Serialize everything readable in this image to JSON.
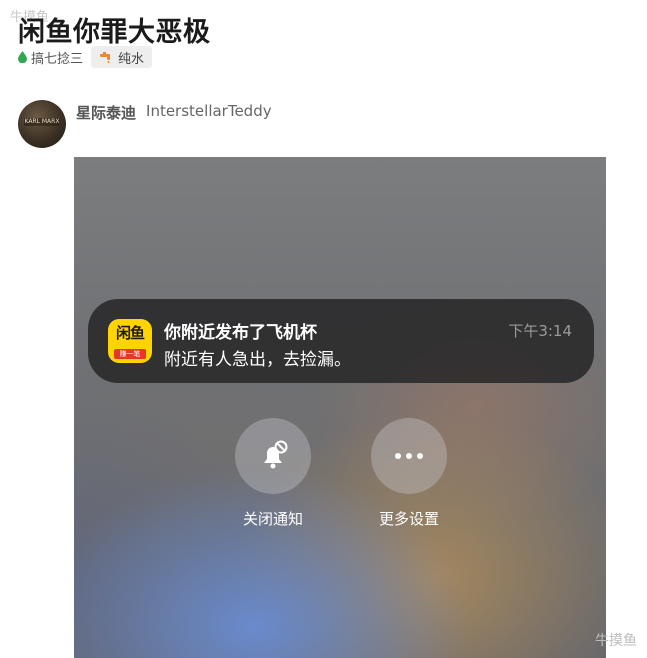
{
  "watermark": "牛摸鱼",
  "post": {
    "title": "闲鱼你罪大恶极",
    "tags": {
      "category": "搞七捻三",
      "water": "纯水"
    }
  },
  "author": {
    "cn_name": "星际泰迪",
    "en_name": "InterstellarTeddy",
    "avatar_text": "KARL MARX"
  },
  "screenshot": {
    "notification": {
      "app_icon_text": "闲鱼",
      "app_icon_sub": "赚一笔",
      "title": "你附近发布了飞机杯",
      "body": "附近有人急出，去捡漏。",
      "time": "下午3:14"
    },
    "actions": [
      {
        "label": "关闭通知",
        "icon": "bell-slash-icon"
      },
      {
        "label": "更多设置",
        "icon": "more-dots-icon"
      }
    ]
  },
  "colors": {
    "drop_icon": "#2fa84f",
    "water_icon": "#f0892b",
    "app_icon_bg": "#ffd400",
    "app_icon_strip": "#e5362c"
  }
}
